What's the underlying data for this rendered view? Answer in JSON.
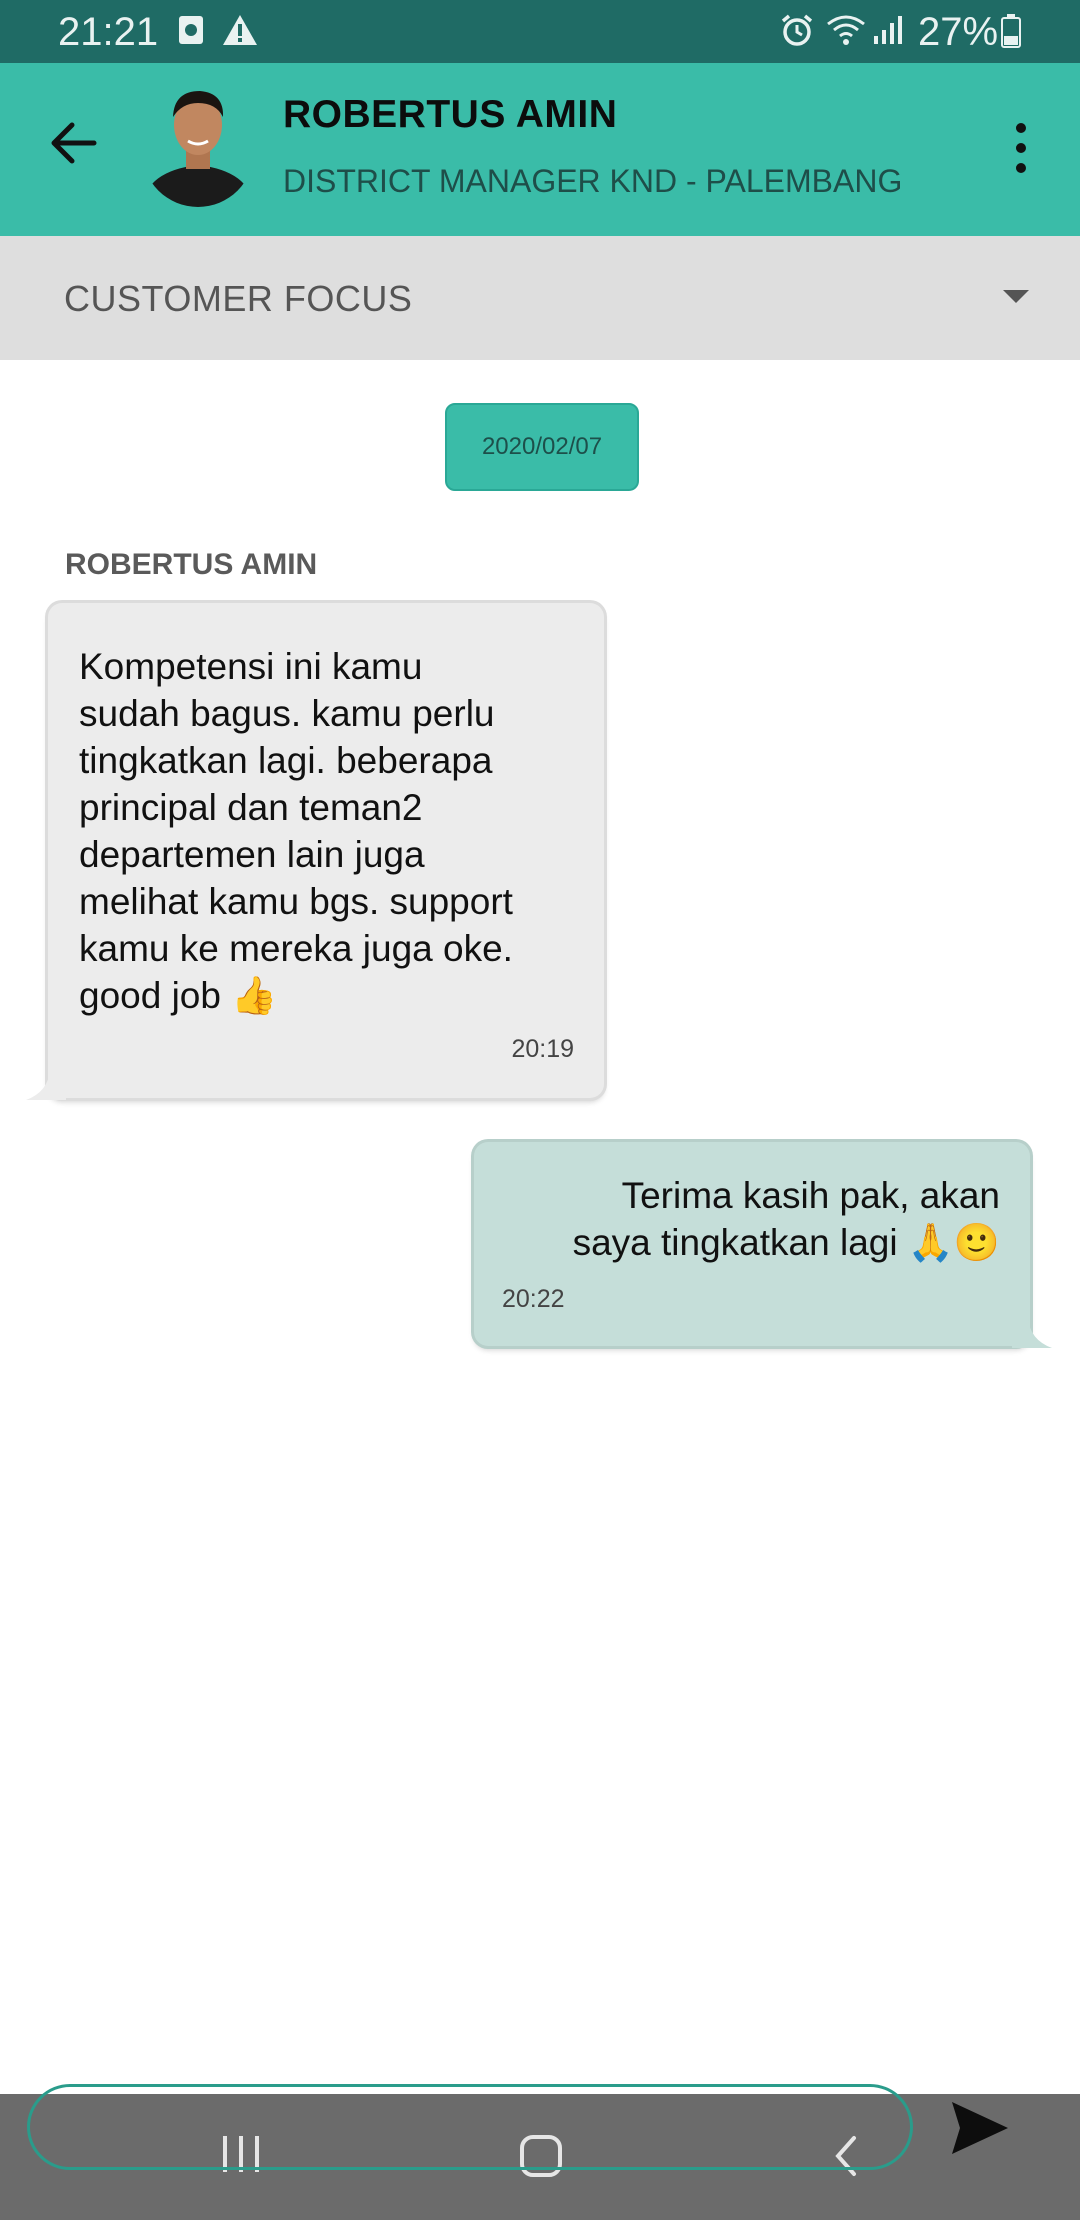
{
  "status_bar": {
    "time": "21:21",
    "battery": "27%",
    "icons": [
      "screenshot-icon",
      "warning-icon",
      "alarm-icon",
      "wifi-icon",
      "signal-icon",
      "battery-icon"
    ]
  },
  "header": {
    "name": "ROBERTUS AMIN",
    "subtitle": "DISTRICT MANAGER KND - PALEMBANG",
    "accent_color": "#3abca8"
  },
  "dropdown": {
    "selected": "CUSTOMER FOCUS"
  },
  "chat": {
    "date": "2020/02/07",
    "sender": "ROBERTUS AMIN",
    "messages": [
      {
        "direction": "incoming",
        "lines": [
          "Kompetensi ini kamu",
          "sudah bagus. kamu perlu",
          "tingkatkan lagi. beberapa",
          "principal dan teman2",
          "departemen lain juga",
          "melihat kamu bgs. support",
          "kamu ke mereka juga oke.",
          "good job 👍"
        ],
        "time": "20:19",
        "color": "#ececec"
      },
      {
        "direction": "outgoing",
        "lines": [
          "Terima kasih pak, akan",
          "saya tingkatkan lagi 🙏🙂"
        ],
        "time": "20:22",
        "color": "#c5ded9"
      }
    ]
  },
  "input": {
    "placeholder": ""
  },
  "nav": {
    "icons": [
      "recents-icon",
      "home-icon",
      "back-nav-icon"
    ]
  }
}
